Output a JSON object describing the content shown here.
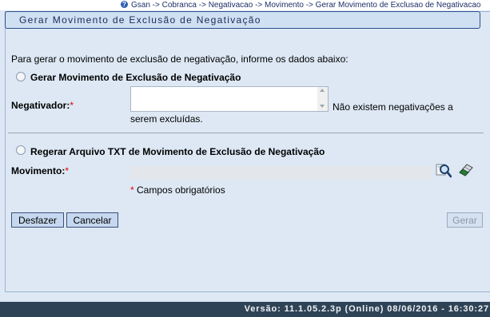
{
  "breadcrumb": "Gsan -> Cobranca -> Negativacao -> Movimento -> Gerar Movimento de Exclusao de Negativacao",
  "title": "Gerar Movimento de Exclusão de Negativação",
  "intro": "Para gerar o movimento de exclusão de negativação, informe os dados abaixo:",
  "option1_label": "Gerar Movimento de Exclusão de Negativação",
  "negativador_label": "Negativador:",
  "required_mark": "*",
  "msg_line1": "Não existem negativações a",
  "msg_line2": "serem excluídas.",
  "option2_label": "Regerar Arquivo TXT de Movimento de Exclusão de Negativação",
  "movimento_label": "Movimento:",
  "movimento_value": "",
  "required_note": "Campos obrigatórios",
  "buttons": {
    "desfazer": "Desfazer",
    "cancelar": "Cancelar",
    "gerar": "Gerar"
  },
  "footer": "Versão: 11.1.05.2.3p (Online) 08/06/2016 - 16:30:27",
  "icons": {
    "help": "help-icon",
    "search": "search-icon",
    "eraser": "eraser-icon"
  },
  "colors": {
    "background": "#dde8f4",
    "title_bg": "#cfe0f3",
    "footer_bg": "#2f4356",
    "required": "#dd0000"
  }
}
